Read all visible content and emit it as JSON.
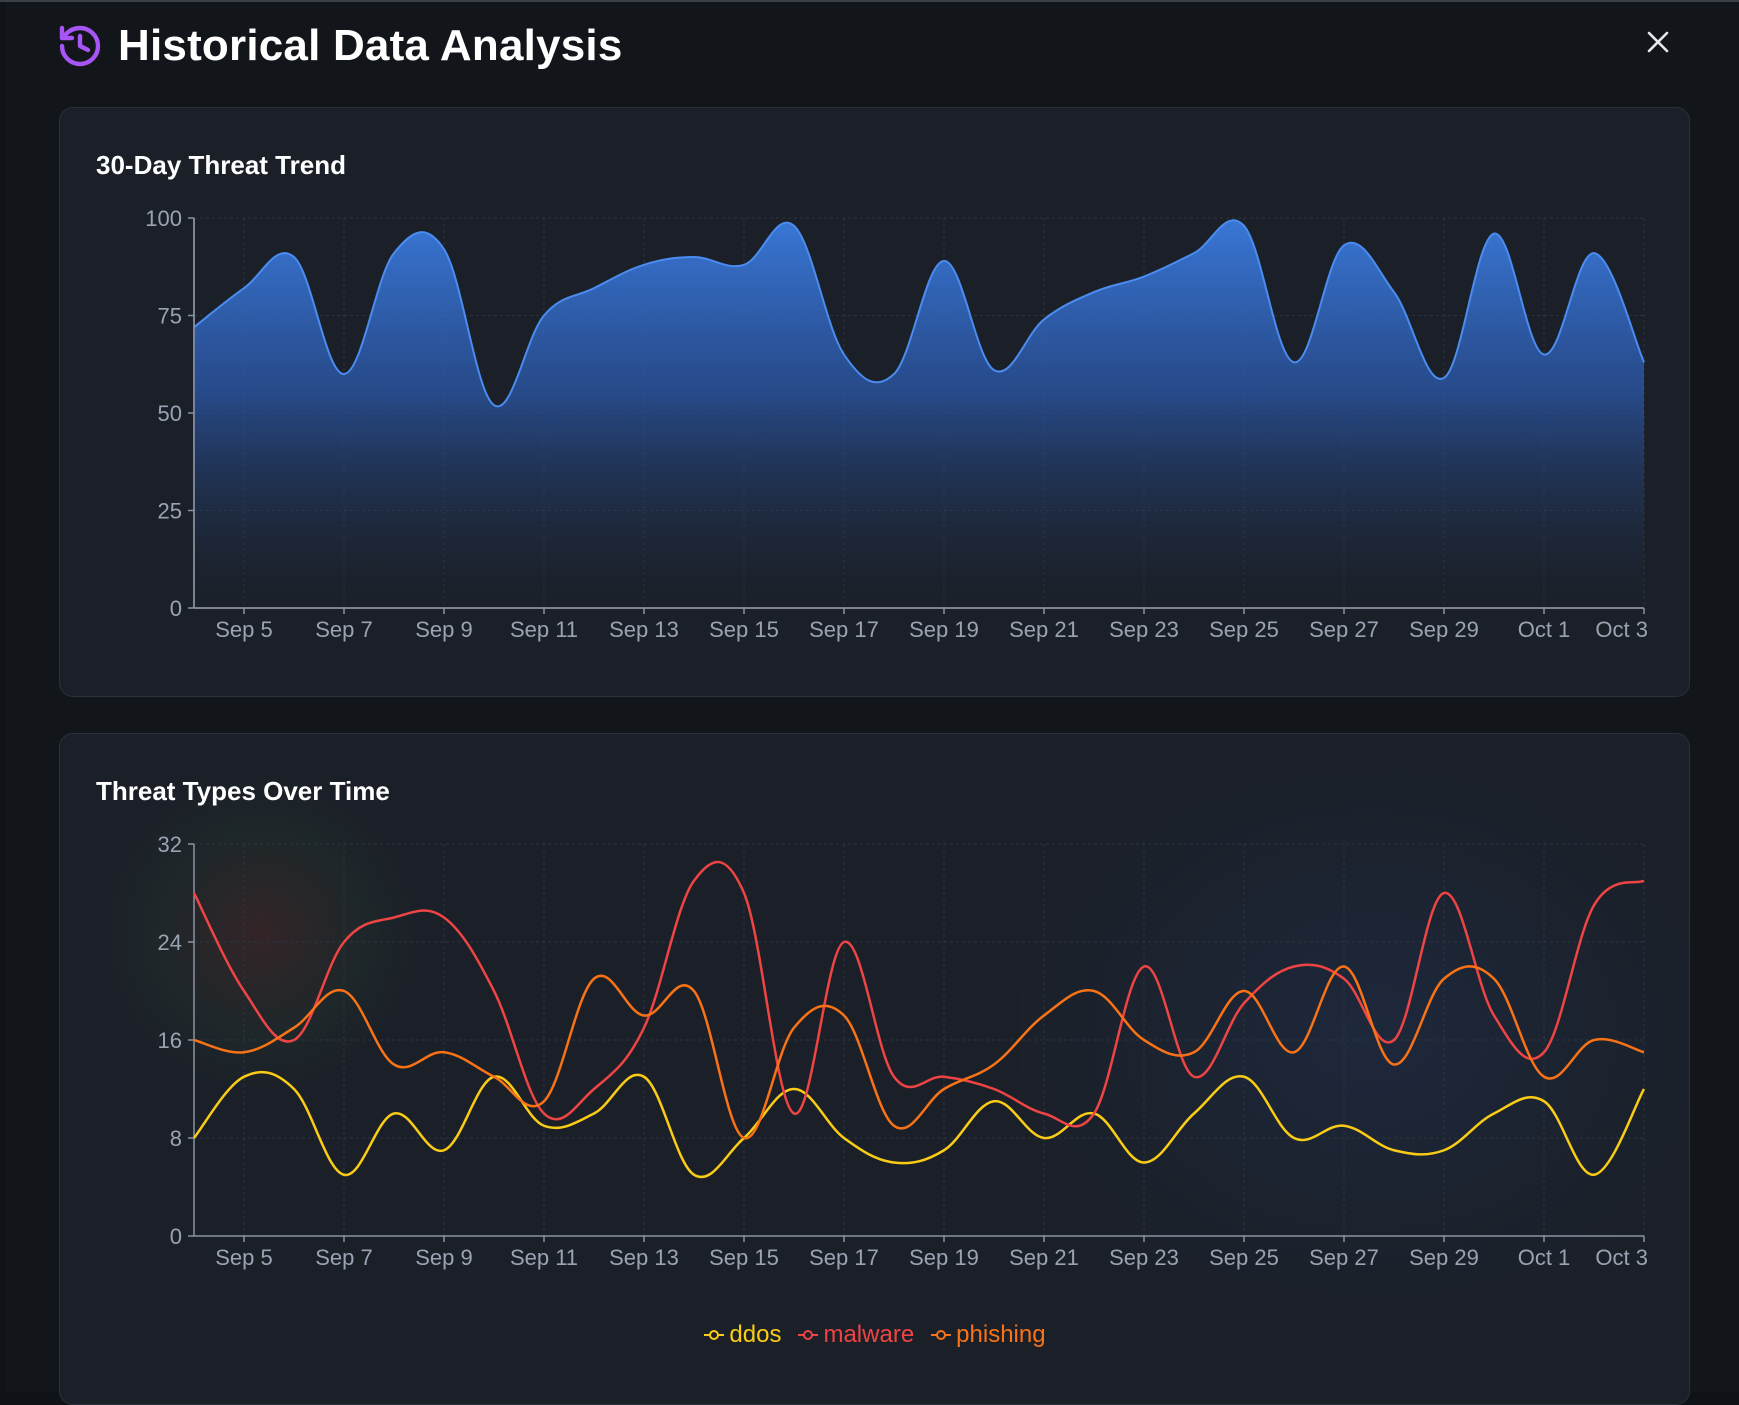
{
  "header": {
    "title": "Historical Data Analysis",
    "icon": "history-icon",
    "icon_color": "#a855f7",
    "close_icon": "close-icon"
  },
  "cards": {
    "trend": {
      "title": "30-Day Threat Trend"
    },
    "types": {
      "title": "Threat Types Over Time"
    }
  },
  "legend": {
    "ddos": "ddos",
    "malware": "malware",
    "phishing": "phishing"
  },
  "chart_data": [
    {
      "type": "area",
      "title": "30-Day Threat Trend",
      "xlabel": "",
      "ylabel": "",
      "x": [
        "Sep 4",
        "Sep 5",
        "Sep 6",
        "Sep 7",
        "Sep 8",
        "Sep 9",
        "Sep 10",
        "Sep 11",
        "Sep 12",
        "Sep 13",
        "Sep 14",
        "Sep 15",
        "Sep 16",
        "Sep 17",
        "Sep 18",
        "Sep 19",
        "Sep 20",
        "Sep 21",
        "Sep 22",
        "Sep 23",
        "Sep 24",
        "Sep 25",
        "Sep 26",
        "Sep 27",
        "Sep 28",
        "Sep 29",
        "Sep 30",
        "Oct 1",
        "Oct 2",
        "Oct 3"
      ],
      "x_ticks": [
        "Sep 5",
        "Sep 7",
        "Sep 9",
        "Sep 11",
        "Sep 13",
        "Sep 15",
        "Sep 17",
        "Sep 19",
        "Sep 21",
        "Sep 23",
        "Sep 25",
        "Sep 27",
        "Sep 29",
        "Oct 1",
        "Oct 3"
      ],
      "values": [
        72,
        82,
        90,
        60,
        91,
        92,
        52,
        75,
        82,
        88,
        90,
        88,
        98,
        65,
        60,
        89,
        61,
        74,
        81,
        85,
        91,
        98,
        63,
        93,
        81,
        59,
        96,
        65,
        91,
        63
      ],
      "ylim": [
        0,
        100
      ],
      "yticks": [
        0,
        25,
        50,
        75,
        100
      ],
      "grid": true,
      "color": "#3a7bdf"
    },
    {
      "type": "line",
      "title": "Threat Types Over Time",
      "xlabel": "",
      "ylabel": "",
      "x": [
        "Sep 4",
        "Sep 5",
        "Sep 6",
        "Sep 7",
        "Sep 8",
        "Sep 9",
        "Sep 10",
        "Sep 11",
        "Sep 12",
        "Sep 13",
        "Sep 14",
        "Sep 15",
        "Sep 16",
        "Sep 17",
        "Sep 18",
        "Sep 19",
        "Sep 20",
        "Sep 21",
        "Sep 22",
        "Sep 23",
        "Sep 24",
        "Sep 25",
        "Sep 26",
        "Sep 27",
        "Sep 28",
        "Sep 29",
        "Sep 30",
        "Oct 1",
        "Oct 2",
        "Oct 3"
      ],
      "x_ticks": [
        "Sep 5",
        "Sep 7",
        "Sep 9",
        "Sep 11",
        "Sep 13",
        "Sep 15",
        "Sep 17",
        "Sep 19",
        "Sep 21",
        "Sep 23",
        "Sep 25",
        "Sep 27",
        "Sep 29",
        "Oct 1",
        "Oct 3"
      ],
      "ylim": [
        0,
        32
      ],
      "yticks": [
        0,
        8,
        16,
        24,
        32
      ],
      "grid": true,
      "legend": "bottom-center",
      "series": [
        {
          "name": "ddos",
          "color": "#facc15",
          "values": [
            8,
            13,
            12,
            5,
            10,
            7,
            13,
            9,
            10,
            13,
            5,
            8,
            12,
            8,
            6,
            7,
            11,
            8,
            10,
            6,
            10,
            13,
            8,
            9,
            7,
            7,
            10,
            11,
            5,
            12
          ]
        },
        {
          "name": "malware",
          "color": "#ef4444",
          "values": [
            28,
            20,
            16,
            24,
            26,
            26,
            20,
            10,
            12,
            17,
            29,
            28,
            10,
            24,
            13,
            13,
            12,
            10,
            10,
            22,
            13,
            19,
            22,
            21,
            16,
            28,
            18,
            15,
            27,
            29
          ]
        },
        {
          "name": "phishing",
          "color": "#f97316",
          "values": [
            16,
            15,
            17,
            20,
            14,
            15,
            13,
            11,
            21,
            18,
            20,
            8,
            17,
            18,
            9,
            12,
            14,
            18,
            20,
            16,
            15,
            20,
            15,
            22,
            14,
            21,
            21,
            13,
            16,
            15
          ]
        }
      ]
    }
  ]
}
